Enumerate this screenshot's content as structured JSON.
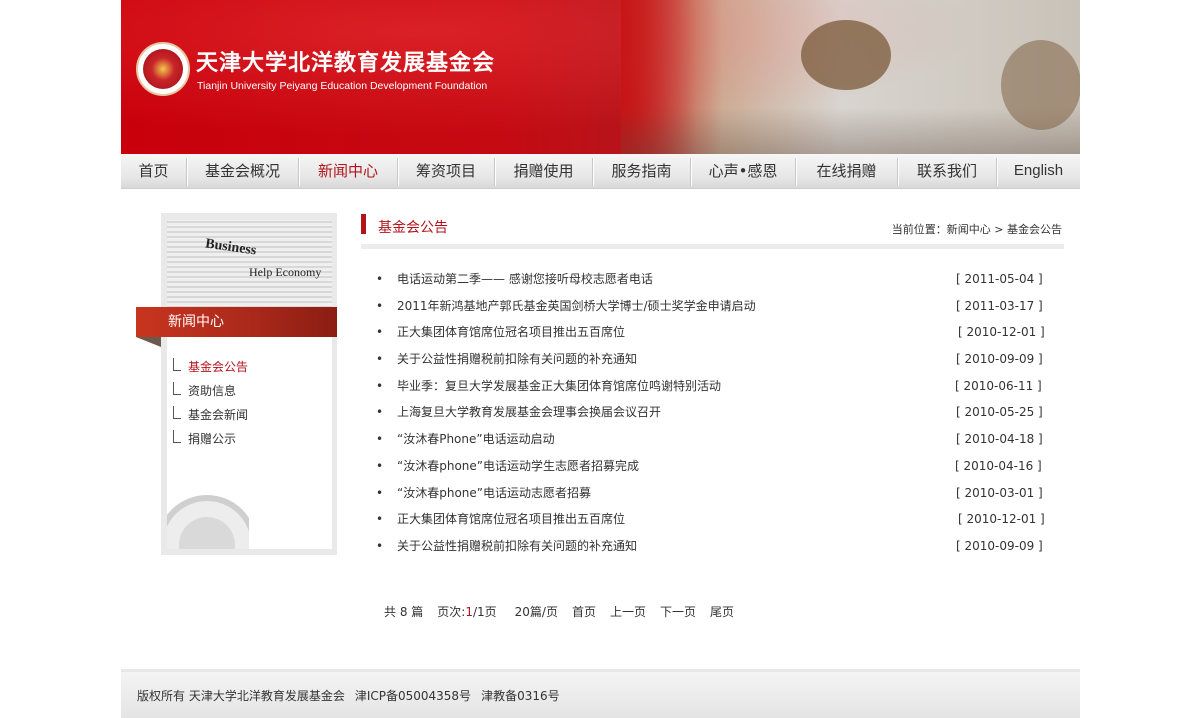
{
  "header": {
    "title_cn": "天津大学北洋教育发展基金会",
    "title_en": "Tianjin University Peiyang Education Development Foundation"
  },
  "nav": {
    "items": [
      {
        "label": "首页"
      },
      {
        "label": "基金会概况"
      },
      {
        "label": "新闻中心",
        "active": true
      },
      {
        "label": "筹资项目"
      },
      {
        "label": "捐赠使用"
      },
      {
        "label": "服务指南"
      },
      {
        "label": "心声•感恩"
      },
      {
        "label": "在线捐赠"
      },
      {
        "label": "联系我们"
      },
      {
        "label": "English"
      }
    ]
  },
  "sidebar": {
    "image_words": [
      "Business",
      "Help Economy"
    ],
    "heading": "新闻中心",
    "items": [
      {
        "label": "基金会公告",
        "active": true
      },
      {
        "label": "资助信息"
      },
      {
        "label": "基金会新闻"
      },
      {
        "label": "捐赠公示"
      }
    ]
  },
  "content": {
    "section_title": "基金会公告",
    "breadcrumb": "当前位置：新闻中心 > 基金会公告",
    "bullet": "•",
    "news": [
      {
        "title": "电话运动第二季—— 感谢您接听母校志愿者电话",
        "date": "[ 2011-05-04 ]"
      },
      {
        "title": "2011年新鸿基地产郭氏基金英国剑桥大学博士/硕士奖学金申请启动",
        "date": "[ 2011-03-17 ]"
      },
      {
        "title": "正大集团体育馆席位冠名项目推出五百席位",
        "date": "[ 2010-12-01 ]"
      },
      {
        "title": "关于公益性捐赠税前扣除有关问题的补充通知",
        "date": "[ 2010-09-09 ]"
      },
      {
        "title": "毕业季：复旦大学发展基金正大集团体育馆席位鸣谢特别活动",
        "date": "[ 2010-06-11 ]"
      },
      {
        "title": "上海复旦大学教育发展基金会理事会换届会议召开",
        "date": "[ 2010-05-25 ]"
      },
      {
        "title": "“汝沐春Phone”电话运动启动",
        "date": "[ 2010-04-18 ]"
      },
      {
        "title": "“汝沐春phone”电话运动学生志愿者招募完成",
        "date": "[ 2010-04-16 ]"
      },
      {
        "title": "“汝沐春phone”电话运动志愿者招募",
        "date": "[ 2010-03-01 ]"
      },
      {
        "title": "正大集团体育馆席位冠名项目推出五百席位",
        "date": "[ 2010-12-01 ]"
      },
      {
        "title": "关于公益性捐赠税前扣除有关问题的补充通知",
        "date": "[ 2010-09-09 ]"
      }
    ]
  },
  "pager": {
    "total": "共 8 篇",
    "page_prefix": "页次:",
    "current_page": "1",
    "page_suffix": "/1页",
    "per_page": "20篇/页",
    "first": "首页",
    "prev": "上一页",
    "next": "下一页",
    "last": "尾页"
  },
  "footer": {
    "copyright": "版权所有 天津大学北洋教育发展基金会",
    "icp": "津ICP备05004358号",
    "edu": "津教备0316号"
  },
  "colors": {
    "brand_red": "#b3131b",
    "banner_red": "#c9000b"
  },
  "icons": [
    "seal-icon",
    "branch-icon"
  ]
}
